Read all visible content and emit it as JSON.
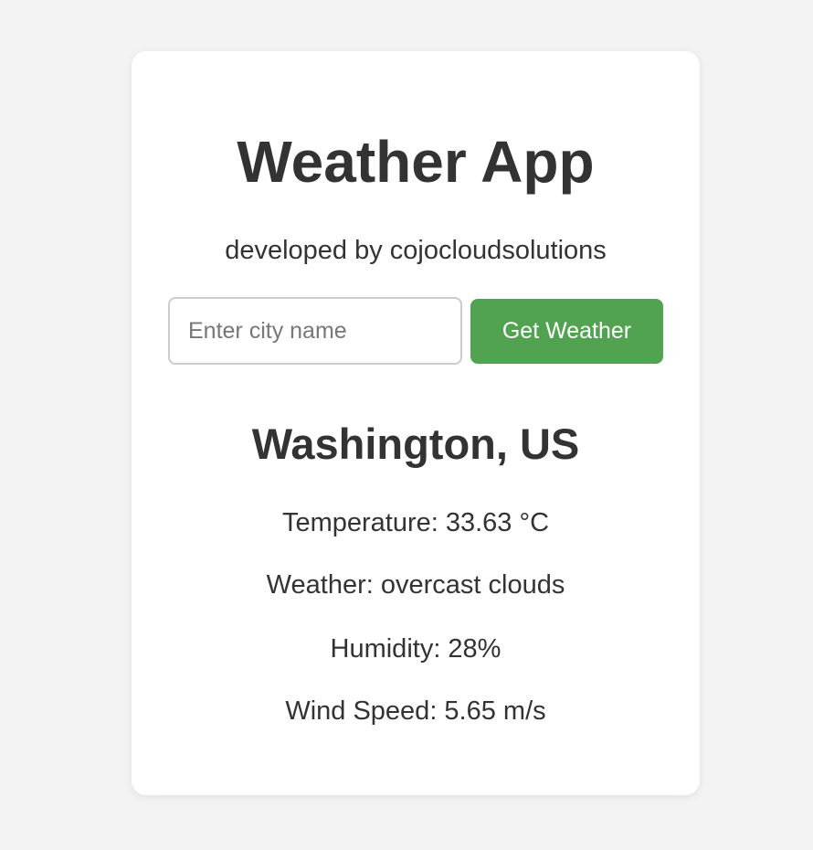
{
  "app": {
    "title": "Weather App",
    "subtitle": "developed by cojocloudsolutions"
  },
  "search": {
    "placeholder": "Enter city name",
    "value": "",
    "button_label": "Get Weather"
  },
  "result": {
    "location": "Washington, US",
    "temperature": "Temperature: 33.63 °C",
    "weather": "Weather: overcast clouds",
    "humidity": "Humidity: 28%",
    "wind_speed": "Wind Speed: 5.65 m/s"
  },
  "colors": {
    "background": "#f3f3f3",
    "card": "#ffffff",
    "text": "#333333",
    "button": "#51a351",
    "button_text": "#ffffff",
    "input_border": "#cccccc"
  }
}
